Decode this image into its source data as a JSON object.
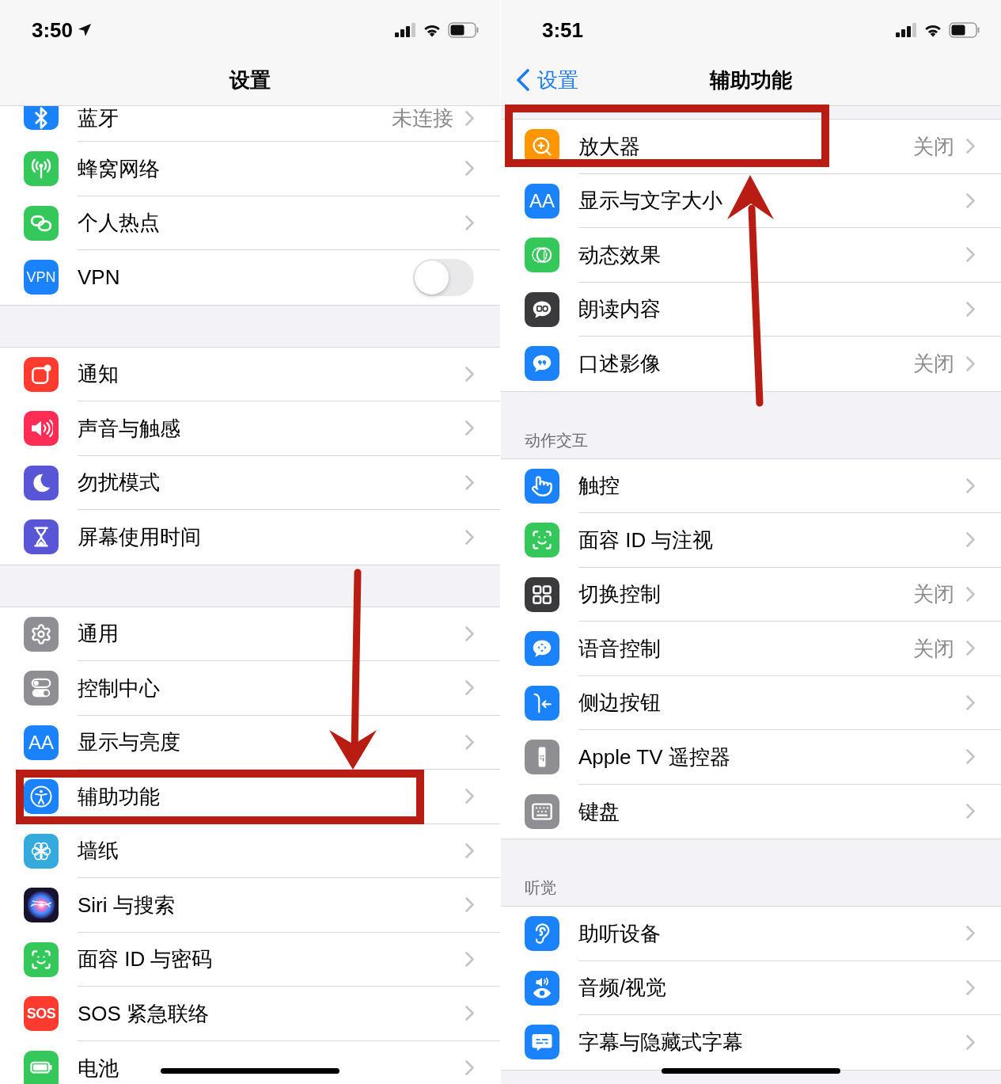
{
  "screens": [
    {
      "status_bar": {
        "time": "3:50",
        "location": true
      },
      "nav": {
        "title": "设置"
      },
      "groups": [
        {
          "rows": [
            {
              "label": "蓝牙",
              "value": "未连接",
              "kind": "link",
              "highlighted": false
            },
            {
              "label": "蜂窝网络",
              "kind": "link",
              "highlighted": false
            },
            {
              "label": "个人热点",
              "kind": "link",
              "highlighted": false
            },
            {
              "label": "VPN",
              "icon_text": "VPN",
              "kind": "toggle",
              "on": false,
              "highlighted": false
            }
          ]
        },
        {
          "rows": [
            {
              "label": "通知",
              "kind": "link",
              "highlighted": false
            },
            {
              "label": "声音与触感",
              "kind": "link",
              "highlighted": false
            },
            {
              "label": "勿扰模式",
              "kind": "link",
              "highlighted": false
            },
            {
              "label": "屏幕使用时间",
              "kind": "link",
              "highlighted": false
            }
          ]
        },
        {
          "rows": [
            {
              "label": "通用",
              "kind": "link",
              "highlighted": false
            },
            {
              "label": "控制中心",
              "kind": "link",
              "highlighted": false
            },
            {
              "label": "显示与亮度",
              "icon_text": "AA",
              "kind": "link",
              "highlighted": false
            },
            {
              "label": "辅助功能",
              "kind": "link",
              "highlighted": true
            },
            {
              "label": "墙纸",
              "kind": "link",
              "highlighted": false
            },
            {
              "label": "Siri 与搜索",
              "kind": "link",
              "highlighted": false
            },
            {
              "label": "面容 ID 与密码",
              "kind": "link",
              "highlighted": false
            },
            {
              "label": "SOS 紧急联络",
              "icon_text": "SOS",
              "kind": "link",
              "highlighted": false
            },
            {
              "label": "电池",
              "kind": "link",
              "highlighted": false
            }
          ]
        }
      ]
    },
    {
      "status_bar": {
        "time": "3:51",
        "location": false
      },
      "nav": {
        "back": "设置",
        "title": "辅助功能"
      },
      "groups": [
        {
          "rows": [
            {
              "label": "放大器",
              "value": "关闭",
              "kind": "link",
              "highlighted": true
            },
            {
              "label": "显示与文字大小",
              "icon_text": "AA",
              "kind": "link",
              "highlighted": false
            },
            {
              "label": "动态效果",
              "kind": "link",
              "highlighted": false
            },
            {
              "label": "朗读内容",
              "kind": "link",
              "highlighted": false
            },
            {
              "label": "口述影像",
              "value": "关闭",
              "kind": "link",
              "highlighted": false
            }
          ]
        },
        {
          "header": "动作交互",
          "rows": [
            {
              "label": "触控",
              "kind": "link",
              "highlighted": false
            },
            {
              "label": "面容 ID 与注视",
              "kind": "link",
              "highlighted": false
            },
            {
              "label": "切换控制",
              "value": "关闭",
              "kind": "link",
              "highlighted": false
            },
            {
              "label": "语音控制",
              "value": "关闭",
              "kind": "link",
              "highlighted": false
            },
            {
              "label": "侧边按钮",
              "kind": "link",
              "highlighted": false
            },
            {
              "label": "Apple TV 遥控器",
              "kind": "link",
              "highlighted": false
            },
            {
              "label": "键盘",
              "kind": "link",
              "highlighted": false
            }
          ]
        },
        {
          "header": "听觉",
          "rows": [
            {
              "label": "助听设备",
              "kind": "link",
              "highlighted": false
            },
            {
              "label": "音频/视觉",
              "kind": "link",
              "highlighted": false
            },
            {
              "label": "字幕与隐藏式字幕",
              "kind": "link",
              "highlighted": false
            }
          ]
        }
      ]
    }
  ]
}
